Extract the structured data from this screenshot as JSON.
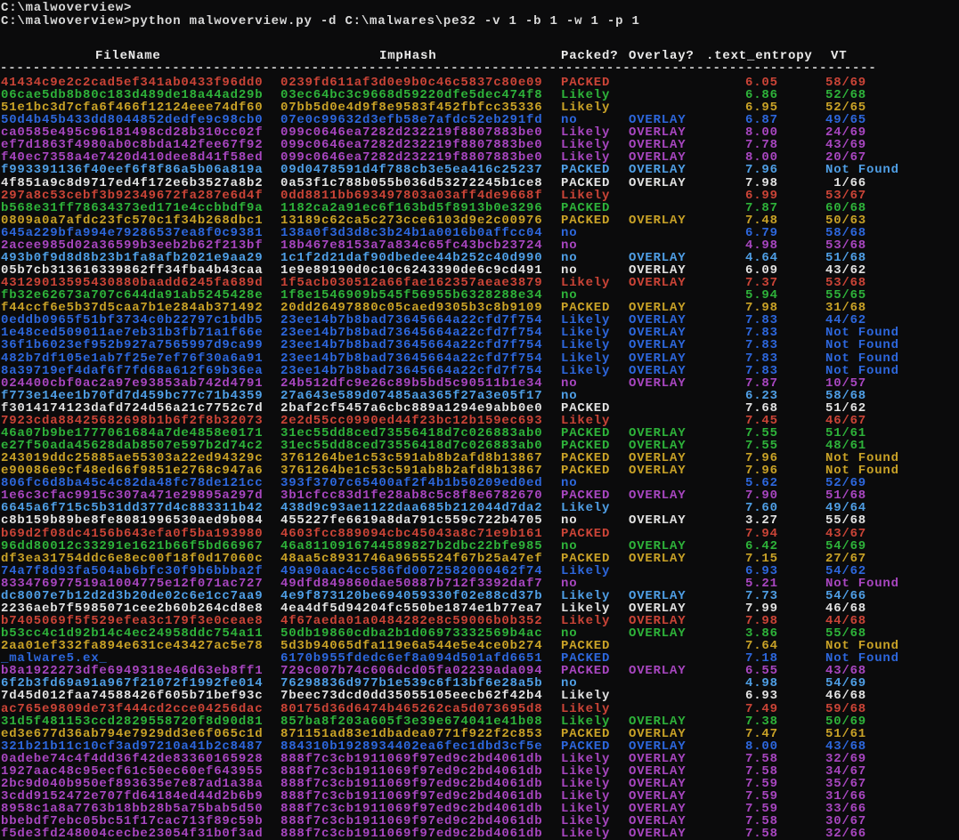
{
  "terminal": {
    "prompt_line1": "C:\\malwoverview>",
    "prompt_line2": "C:\\malwoverview>python malwoverview.py -d C:\\malwares\\pe32 -v 1 -b 1 -w 1 -p 1",
    "columns": {
      "filename": "FileName",
      "imphash": "ImpHash",
      "packed": "Packed?",
      "overlay": "Overlay?",
      "entropy": ".text_entropy",
      "vt": "VT"
    },
    "separator": "-----------------------------------------------------------------------------------------------------------",
    "palette": {
      "red": "#cb4437",
      "green": "#2eb33a",
      "yellow": "#c9a227",
      "blue": "#2d67dd",
      "magenta": "#a846c0",
      "cyan": "#4f9fe6",
      "white": "#e2e2e2"
    },
    "rows": [
      {
        "filename": "41434c9e2c2cad5ef341ab0433f96dd0",
        "imphash": "0239fd611af3d0e9b0c46c5837c80e09",
        "packed": "PACKED",
        "overlay": "",
        "entropy": "6.05",
        "vt": "58/69",
        "color": "red"
      },
      {
        "filename": "06cae5db8b80c183d489de18a44ad29b",
        "imphash": "03ec64bc3c9668d59220dfe5dec474f8",
        "packed": "Likely",
        "overlay": "",
        "entropy": "6.86",
        "vt": "52/68",
        "color": "green"
      },
      {
        "filename": "51e1bc3d7cfa6f466f12124eee74df60",
        "imphash": "07bb5d0e4d9f8e9583f452fbfcc35336",
        "packed": "Likely",
        "overlay": "",
        "entropy": "6.95",
        "vt": "52/65",
        "color": "yellow"
      },
      {
        "filename": "50d4b45b433dd8044852dedfe9c98cb0",
        "imphash": "07e0c99632d3efb58e7afdc52eb291fd",
        "packed": "no",
        "overlay": "OVERLAY",
        "entropy": "6.87",
        "vt": "49/65",
        "color": "blue"
      },
      {
        "filename": "ca0585e495c96181498cd28b310cc02f",
        "imphash": "099c0646ea7282d232219f8807883be0",
        "packed": "Likely",
        "overlay": "OVERLAY",
        "entropy": "8.00",
        "vt": "24/69",
        "color": "magenta"
      },
      {
        "filename": "ef7d1863f4980ab0c8bda142fee67f92",
        "imphash": "099c0646ea7282d232219f8807883be0",
        "packed": "Likely",
        "overlay": "OVERLAY",
        "entropy": "7.78",
        "vt": "43/69",
        "color": "magenta"
      },
      {
        "filename": "f40ec7358a4e7420d410dee8d41f58ed",
        "imphash": "099c0646ea7282d232219f8807883be0",
        "packed": "Likely",
        "overlay": "OVERLAY",
        "entropy": "8.00",
        "vt": "20/67",
        "color": "magenta"
      },
      {
        "filename": "f993391136f40eef6f8f86a5b06a819a",
        "imphash": "09d0478591d4f788cb3e5ea416c25237",
        "packed": "PACKED",
        "overlay": "OVERLAY",
        "entropy": "7.96",
        "vt": "Not Found",
        "color": "cyan"
      },
      {
        "filename": "4f851a9c8d9717ed4f172e6b3527a8b2",
        "imphash": "0a53f1c788b055b036d53272245b1ce8",
        "packed": "PACKED",
        "overlay": "OVERLAY",
        "entropy": "7.98",
        "vt": " 1/66",
        "color": "white"
      },
      {
        "filename": "297a8c53cebf3b92349672fa287e6d4f",
        "imphash": "0dd8811bb693497803a03aff4de9668f",
        "packed": "Likely",
        "overlay": "",
        "entropy": "6.99",
        "vt": "53/67",
        "color": "red"
      },
      {
        "filename": "b568e31ff78634373ed171e4ccbbdf9a",
        "imphash": "1182ca2a91ec6f163bd5f8913b0e3296",
        "packed": "PACKED",
        "overlay": "",
        "entropy": "7.87",
        "vt": "60/68",
        "color": "green"
      },
      {
        "filename": "0809a0a7afdc23fc570c1f34b268dbc1",
        "imphash": "13189c62ca5c273cce6103d9e2c00976",
        "packed": "PACKED",
        "overlay": "OVERLAY",
        "entropy": "7.48",
        "vt": "50/63",
        "color": "yellow"
      },
      {
        "filename": "645a229bfa994e79286537ea8f0c9381",
        "imphash": "138a0f3d3d8c3b24b1a0016b0affcc04",
        "packed": "no",
        "overlay": "",
        "entropy": "6.79",
        "vt": "58/68",
        "color": "blue"
      },
      {
        "filename": "2acee985d02a36599b3eeb2b62f213bf",
        "imphash": "18b467e8153a7a834c65fc43bcb23724",
        "packed": "no",
        "overlay": "",
        "entropy": "4.98",
        "vt": "53/68",
        "color": "magenta"
      },
      {
        "filename": "493b0f9d8d8b23b1fa8afb2021e9aa29",
        "imphash": "1c1f2d21daf90dbedee44b252c40d990",
        "packed": "no",
        "overlay": "OVERLAY",
        "entropy": "4.64",
        "vt": "51/68",
        "color": "cyan"
      },
      {
        "filename": "05b7cb313616339862ff34fba4b43caa",
        "imphash": "1e9e89190d0c10c6243390de6c9cd491",
        "packed": "no",
        "overlay": "OVERLAY",
        "entropy": "6.09",
        "vt": "43/62",
        "color": "white"
      },
      {
        "filename": "43129013595430880baadd6245fa689d",
        "imphash": "1f5acb030512a66fae162357aeae3879",
        "packed": "Likely",
        "overlay": "OVERLAY",
        "entropy": "7.37",
        "vt": "53/68",
        "color": "red"
      },
      {
        "filename": "fb32e62673a707c644da91ab5245428e",
        "imphash": "1f8e1546909b545f56955b6328288e34",
        "packed": "no",
        "overlay": "",
        "entropy": "5.94",
        "vt": "55/65",
        "color": "green"
      },
      {
        "filename": "f44ccf6e5b37d5caa7b1e284ab371492",
        "imphash": "20dd26497880c05caed9305b3c8b9109",
        "packed": "PACKED",
        "overlay": "OVERLAY",
        "entropy": "7.98",
        "vt": "31/68",
        "color": "yellow"
      },
      {
        "filename": "0eddb0965f51bf3734c0b22797c1bdb5",
        "imphash": "23ee14b7b8bad73645664a22cfd7f754",
        "packed": "Likely",
        "overlay": "OVERLAY",
        "entropy": "7.83",
        "vt": "44/62",
        "color": "blue"
      },
      {
        "filename": "1e48ced509011ae7eb31b3fb71a1f66e",
        "imphash": "23ee14b7b8bad73645664a22cfd7f754",
        "packed": "Likely",
        "overlay": "OVERLAY",
        "entropy": "7.83",
        "vt": "Not Found",
        "color": "blue"
      },
      {
        "filename": "36f1b6023ef952b927a7565997d9ca99",
        "imphash": "23ee14b7b8bad73645664a22cfd7f754",
        "packed": "Likely",
        "overlay": "OVERLAY",
        "entropy": "7.83",
        "vt": "Not Found",
        "color": "blue"
      },
      {
        "filename": "482b7df105e1ab7f25e7ef76f30a6a91",
        "imphash": "23ee14b7b8bad73645664a22cfd7f754",
        "packed": "Likely",
        "overlay": "OVERLAY",
        "entropy": "7.83",
        "vt": "Not Found",
        "color": "blue"
      },
      {
        "filename": "8a39719ef4daf6f7fd68a612f69b36ea",
        "imphash": "23ee14b7b8bad73645664a22cfd7f754",
        "packed": "Likely",
        "overlay": "OVERLAY",
        "entropy": "7.83",
        "vt": "Not Found",
        "color": "blue"
      },
      {
        "filename": "024400cbf0ac2a97e93853ab742d4791",
        "imphash": "24b512dfc9e26c89b5bd5c90511b1e34",
        "packed": "no",
        "overlay": "OVERLAY",
        "entropy": "7.87",
        "vt": "10/57",
        "color": "magenta"
      },
      {
        "filename": "f773e14ee1b70fd7d459bc77c71b4359",
        "imphash": "27a643e589d07485aa365f27a3e05f17",
        "packed": "no",
        "overlay": "",
        "entropy": "6.23",
        "vt": "58/68",
        "color": "cyan"
      },
      {
        "filename": "f3014174123dafd724d56a21c7752c7d",
        "imphash": "2baf2cf5457a6cbc889a1294e9abb0e0",
        "packed": "PACKED",
        "overlay": "",
        "entropy": "7.68",
        "vt": "51/62",
        "color": "white"
      },
      {
        "filename": "7923cda88425682698b1b6f2f8b32073",
        "imphash": "2e2d55cc0990ed44f23bc12b159ec693",
        "packed": "Likely",
        "overlay": "",
        "entropy": "7.45",
        "vt": "46/67",
        "color": "red"
      },
      {
        "filename": "46a07b9be1777061684a7de4858e0171",
        "imphash": "31ec55dd8ced73556418d7c026883ab0",
        "packed": "PACKED",
        "overlay": "OVERLAY",
        "entropy": "7.55",
        "vt": "51/61",
        "color": "green"
      },
      {
        "filename": "e27f50ada45628dab8507e597b2d74c2",
        "imphash": "31ec55dd8ced73556418d7c026883ab0",
        "packed": "PACKED",
        "overlay": "OVERLAY",
        "entropy": "7.55",
        "vt": "48/61",
        "color": "green"
      },
      {
        "filename": "243019ddc25885ae55303a22ed94329c",
        "imphash": "3761264be1c53c591ab8b2afd8b13867",
        "packed": "PACKED",
        "overlay": "OVERLAY",
        "entropy": "7.96",
        "vt": "Not Found",
        "color": "yellow"
      },
      {
        "filename": "e90086e9cf48ed66f9851e2768c947a6",
        "imphash": "3761264be1c53c591ab8b2afd8b13867",
        "packed": "PACKED",
        "overlay": "OVERLAY",
        "entropy": "7.96",
        "vt": "Not Found",
        "color": "yellow"
      },
      {
        "filename": "806fc6d8ba45c4c82da48fc78de121cc",
        "imphash": "393f3707c65400af2f4b1b50209ed0ed",
        "packed": "no",
        "overlay": "",
        "entropy": "5.62",
        "vt": "52/69",
        "color": "blue"
      },
      {
        "filename": "1e6c3cfac9915c307a471e29895a297d",
        "imphash": "3b1cfcc83d1fe28ab8c5c8f8e6782670",
        "packed": "PACKED",
        "overlay": "OVERLAY",
        "entropy": "7.90",
        "vt": "51/68",
        "color": "magenta"
      },
      {
        "filename": "6645a6f715c5b31dd377d4c883311b42",
        "imphash": "438d9c93ae1122daa685b212044d7da2",
        "packed": "Likely",
        "overlay": "",
        "entropy": "7.60",
        "vt": "49/64",
        "color": "cyan"
      },
      {
        "filename": "c8b159b89be8fe8081996530aed9b084",
        "imphash": "455227fe6619a8da791c559c722b4705",
        "packed": "no",
        "overlay": "OVERLAY",
        "entropy": "3.27",
        "vt": "55/68",
        "color": "white"
      },
      {
        "filename": "b69d2f08dc4156b643efa0f5ba193980",
        "imphash": "4603fcc889094cbc45043a8c71e9b161",
        "packed": "PACKED",
        "overlay": "",
        "entropy": "7.94",
        "vt": "43/67",
        "color": "red"
      },
      {
        "filename": "96dd80012c33291e1621b66f5bd66967",
        "imphash": "46a8110916744589827b2dbc22bfe985",
        "packed": "no",
        "overlay": "OVERLAY",
        "entropy": "6.42",
        "vt": "54/69",
        "color": "green"
      },
      {
        "filename": "df3ea31754ddc6e8ec00f18f0d17060c",
        "imphash": "48aa5c8931746a9655524f67b25a47ef",
        "packed": "PACKED",
        "overlay": "OVERLAY",
        "entropy": "7.15",
        "vt": "27/67",
        "color": "yellow"
      },
      {
        "filename": "74a7f8d93fa504ab6bfc30f9b6bbba2f",
        "imphash": "49a90aac4cc586fd0072582000462f74",
        "packed": "Likely",
        "overlay": "",
        "entropy": "6.93",
        "vt": "54/62",
        "color": "blue"
      },
      {
        "filename": "833476977519a1004775e12f071ac727",
        "imphash": "49dfd849860dae50887b712f3392daf7",
        "packed": "no",
        "overlay": "",
        "entropy": "5.21",
        "vt": "Not Found",
        "color": "magenta"
      },
      {
        "filename": "dc8007e7b12d2d3b20de02c6e1cc7aa9",
        "imphash": "4e9f873120be694059330f02e88cd37b",
        "packed": "Likely",
        "overlay": "OVERLAY",
        "entropy": "7.73",
        "vt": "54/66",
        "color": "cyan"
      },
      {
        "filename": "2236aeb7f5985071cee2b60b264cd8e8",
        "imphash": "4ea4df5d94204fc550be1874e1b77ea7",
        "packed": "Likely",
        "overlay": "OVERLAY",
        "entropy": "7.99",
        "vt": "46/68",
        "color": "white"
      },
      {
        "filename": "b7405069f5f529efea3c179f3e0ceae8",
        "imphash": "4f67aeda01a0484282e8c59006b0b352",
        "packed": "Likely",
        "overlay": "OVERLAY",
        "entropy": "7.98",
        "vt": "44/68",
        "color": "red"
      },
      {
        "filename": "b53cc4c1d92b14c4ec24958ddc754a11",
        "imphash": "50db19860cdba2b1d06973332569b4ac",
        "packed": "no",
        "overlay": "OVERLAY",
        "entropy": "3.86",
        "vt": "55/68",
        "color": "green"
      },
      {
        "filename": "2aa01ef332fa894e631ce43427ac5e78",
        "imphash": "5d3b94065dfa119e6a544e5e4ce0b274",
        "packed": "PACKED",
        "overlay": "",
        "entropy": "7.64",
        "vt": "Not Found",
        "color": "yellow"
      },
      {
        "filename": "_malware5.ex_",
        "imphash": "6170b955fdedc6ef8a094d501afd6651",
        "packed": "PACKED",
        "overlay": "",
        "entropy": "7.18",
        "vt": "Not Found",
        "color": "blue"
      },
      {
        "filename": "b8a1922273dfe6949318e46d63eb8ff1",
        "imphash": "729c007b74c606dcd05fa02239ada094",
        "packed": "PACKED",
        "overlay": "OVERLAY",
        "entropy": "6.55",
        "vt": "43/68",
        "color": "magenta"
      },
      {
        "filename": "6f2b3fd69a91a967f21072f1992fe014",
        "imphash": "76298836d977b1e539c6f13bf6e28a5b",
        "packed": "no",
        "overlay": "",
        "entropy": "4.98",
        "vt": "54/69",
        "color": "cyan"
      },
      {
        "filename": "7d45d012faa74588426f605b71bef93c",
        "imphash": "7beec73dcd0dd35055105eecb62f42b4",
        "packed": "Likely",
        "overlay": "",
        "entropy": "6.93",
        "vt": "46/68",
        "color": "white"
      },
      {
        "filename": "ac765e9809de73f444cd2cce04256dac",
        "imphash": "80175d36d6474b465262ca5d073695d8",
        "packed": "Likely",
        "overlay": "",
        "entropy": "7.49",
        "vt": "59/68",
        "color": "red"
      },
      {
        "filename": "31d5f481153ccd2829558720f8d90d81",
        "imphash": "857ba8f203a605f3e39e674041e41b08",
        "packed": "Likely",
        "overlay": "OVERLAY",
        "entropy": "7.38",
        "vt": "50/69",
        "color": "green"
      },
      {
        "filename": "ed3e677d36ab794e7929dd3e6f065c1d",
        "imphash": "871151ad83e1dbadea0771f922f2c853",
        "packed": "PACKED",
        "overlay": "OVERLAY",
        "entropy": "7.47",
        "vt": "51/61",
        "color": "yellow"
      },
      {
        "filename": "321b21b11c10cf3ad97210a41b2c8487",
        "imphash": "884310b1928934402ea6fec1dbd3cf5e",
        "packed": "PACKED",
        "overlay": "OVERLAY",
        "entropy": "8.00",
        "vt": "43/68",
        "color": "blue"
      },
      {
        "filename": "0adebe74c4f4dd36f42de83360165928",
        "imphash": "888f7c3cb1911069f97ed9c2bd4061db",
        "packed": "Likely",
        "overlay": "OVERLAY",
        "entropy": "7.58",
        "vt": "32/69",
        "color": "magenta"
      },
      {
        "filename": "1927aac48c95ecf61c50ec60ef643955",
        "imphash": "888f7c3cb1911069f97ed9c2bd4061db",
        "packed": "Likely",
        "overlay": "OVERLAY",
        "entropy": "7.58",
        "vt": "34/67",
        "color": "magenta"
      },
      {
        "filename": "2bc9d040b950ef893635e7e87ad1a38a",
        "imphash": "888f7c3cb1911069f97ed9c2bd4061db",
        "packed": "Likely",
        "overlay": "OVERLAY",
        "entropy": "7.59",
        "vt": "35/67",
        "color": "magenta"
      },
      {
        "filename": "3cdd9152472e707fd64184ed44d2b6b9",
        "imphash": "888f7c3cb1911069f97ed9c2bd4061db",
        "packed": "Likely",
        "overlay": "OVERLAY",
        "entropy": "7.59",
        "vt": "31/66",
        "color": "magenta"
      },
      {
        "filename": "8958c1a8a7763b18bb28b5a75bab5d50",
        "imphash": "888f7c3cb1911069f97ed9c2bd4061db",
        "packed": "Likely",
        "overlay": "OVERLAY",
        "entropy": "7.59",
        "vt": "33/66",
        "color": "magenta"
      },
      {
        "filename": "bbebdf7ebc05bc51f17cac713f89c59b",
        "imphash": "888f7c3cb1911069f97ed9c2bd4061db",
        "packed": "Likely",
        "overlay": "OVERLAY",
        "entropy": "7.58",
        "vt": "30/67",
        "color": "magenta"
      },
      {
        "filename": "f5de3fd248004cecbe23054f31b0f3ad",
        "imphash": "888f7c3cb1911069f97ed9c2bd4061db",
        "packed": "Likely",
        "overlay": "OVERLAY",
        "entropy": "7.58",
        "vt": "32/66",
        "color": "magenta"
      }
    ]
  }
}
